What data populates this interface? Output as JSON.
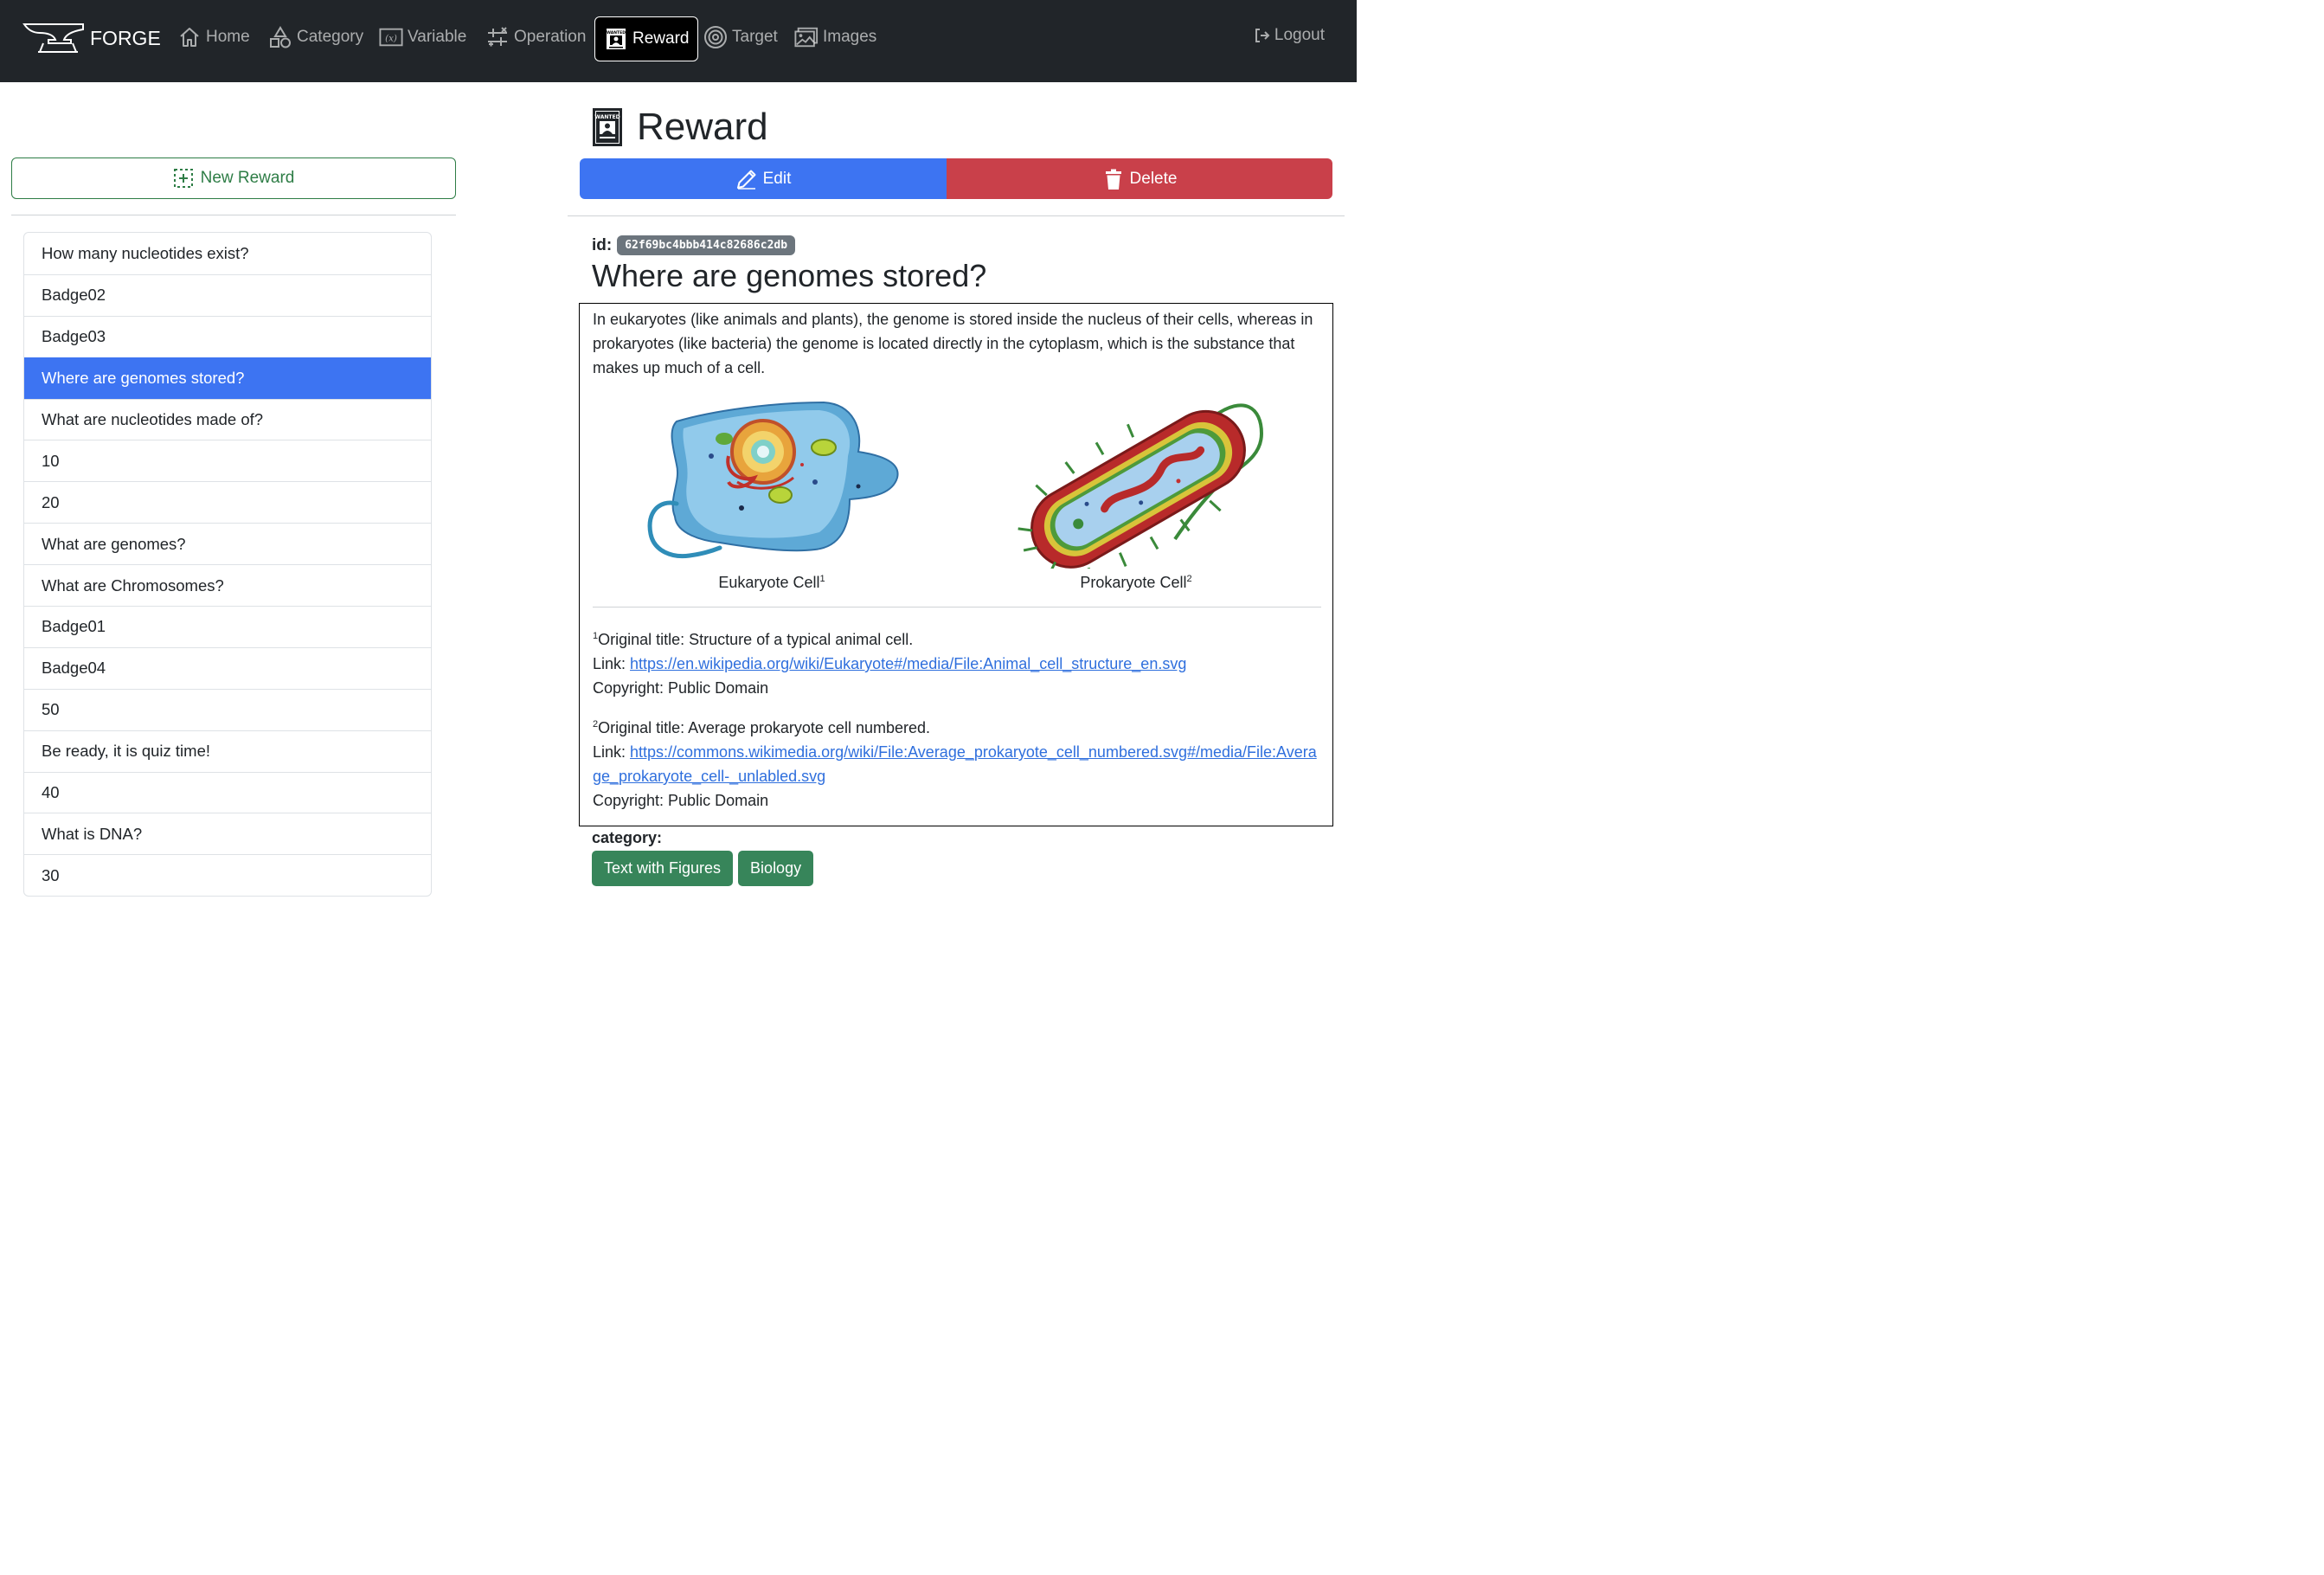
{
  "nav": {
    "brand": "FORGE",
    "items": [
      {
        "label": "Home",
        "icon": "house-icon"
      },
      {
        "label": "Category",
        "icon": "shapes-icon"
      },
      {
        "label": "Variable",
        "icon": "variable-icon"
      },
      {
        "label": "Operation",
        "icon": "sliders-icon"
      },
      {
        "label": "Reward",
        "icon": "wanted-poster-icon",
        "active": true
      },
      {
        "label": "Target",
        "icon": "bullseye-icon"
      },
      {
        "label": "Images",
        "icon": "images-icon"
      }
    ],
    "logout": "Logout"
  },
  "sidebar": {
    "new_button": "New Reward",
    "items": [
      "How many nucleotides exist?",
      "Badge02",
      "Badge03",
      "Where are genomes stored?",
      "What are nucleotides made of?",
      "10",
      "20",
      "What are genomes?",
      "What are Chromosomes?",
      "Badge01",
      "Badge04",
      "50",
      "Be ready, it is quiz time!",
      "40",
      "What is DNA?",
      "30"
    ],
    "selected_index": 3
  },
  "main": {
    "page_title": "Reward",
    "edit_label": "Edit",
    "delete_label": "Delete",
    "id_label": "id:",
    "id_value": "62f69bc4bbb414c82686c2db",
    "reward_title": "Where are genomes stored?",
    "description": "In eukaryotes (like animals and plants), the genome is stored inside the nucleus of their cells, whereas in prokaryotes (like bacteria) the genome is located directly in the cytoplasm, which is the substance that makes up much of a cell.",
    "figures": [
      {
        "caption": "Eukaryote Cell",
        "sup": "1"
      },
      {
        "caption": "Prokaryote Cell",
        "sup": "2"
      }
    ],
    "footnotes": [
      {
        "sup": "1",
        "title_line": "Original title: Structure of a typical animal cell.",
        "link_label": "Link: ",
        "link": "https://en.wikipedia.org/wiki/Eukaryote#/media/File:Animal_cell_structure_en.svg",
        "copyright": "Copyright: Public Domain"
      },
      {
        "sup": "2",
        "title_line": "Original title: Average prokaryote cell numbered.",
        "link_label": "Link: ",
        "link": "https://commons.wikimedia.org/wiki/File:Average_prokaryote_cell_numbered.svg#/media/File:Average_prokaryote_cell-_unlabled.svg",
        "copyright": "Copyright: Public Domain"
      }
    ],
    "category_label": "category:",
    "tags": [
      "Text with Figures",
      "Biology"
    ]
  },
  "colors": {
    "navbar": "#212529",
    "primary": "#3d74f2",
    "danger": "#c9404a",
    "success": "#37855a",
    "outline_success": "#2e7d46",
    "badge": "#6c757d"
  }
}
